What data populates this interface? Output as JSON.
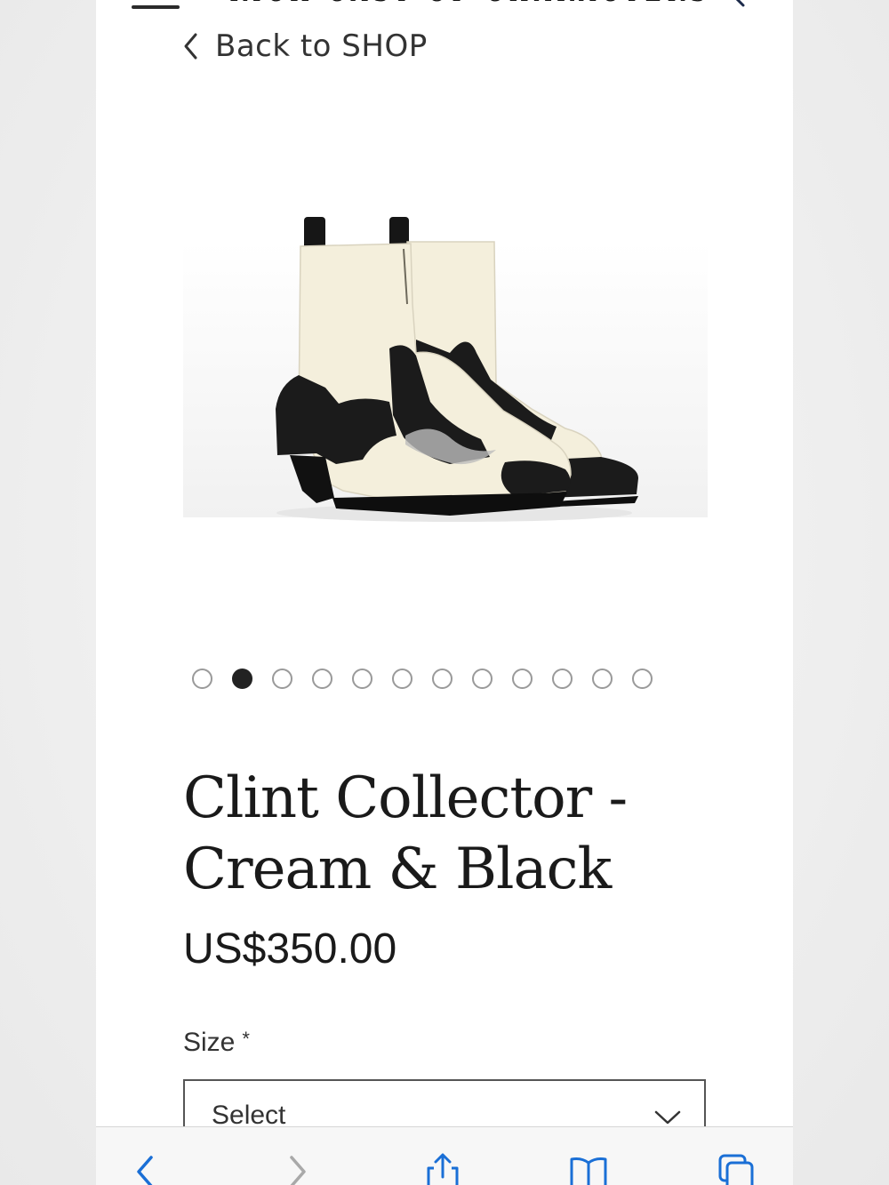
{
  "header": {
    "brand": "RICH CAST OF CHARACTERS",
    "menu_icon": "hamburger-icon",
    "search_icon": "search-icon"
  },
  "nav": {
    "back_label": "Back to SHOP"
  },
  "product": {
    "image_alt": "ankle-boot-image",
    "gallery_count": 12,
    "gallery_active_index": 1,
    "title_line1": "Clint Collector -",
    "title_line2": "Cream & Black",
    "price": "US$350.00"
  },
  "form": {
    "size_label": "Size",
    "size_required_mark": "*",
    "size_selected": "Select"
  },
  "toolbar": {
    "icons": [
      "back-arrow-icon",
      "forward-arrow-icon",
      "share-icon",
      "bookmarks-icon",
      "tabs-icon"
    ]
  },
  "colors": {
    "accent": "#1a6fd6",
    "text": "#1a1a1a",
    "boot_cream": "#f4efdc",
    "boot_black": "#1b1b1b"
  }
}
